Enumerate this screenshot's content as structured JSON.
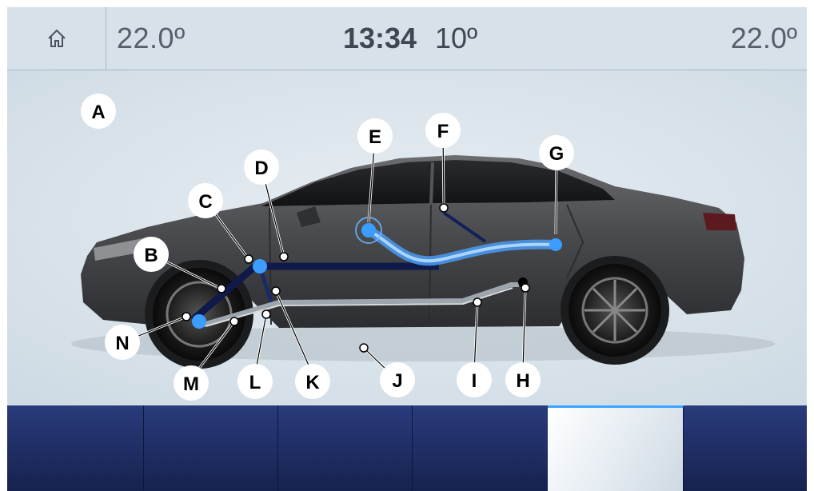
{
  "header": {
    "home_icon": "home-icon",
    "temp_left": "22.0º",
    "clock": "13:34",
    "outside_temp": "10º",
    "temp_right": "22.0º"
  },
  "callouts": [
    "A",
    "B",
    "C",
    "D",
    "E",
    "F",
    "G",
    "H",
    "I",
    "J",
    "K",
    "L",
    "M",
    "N"
  ],
  "colors": {
    "accent": "#3aa3ff",
    "bottombar": "#1c2a60",
    "car_body": "#4a4b4f"
  },
  "bottom_bar": {
    "buttons": 6,
    "active_index": 4
  }
}
